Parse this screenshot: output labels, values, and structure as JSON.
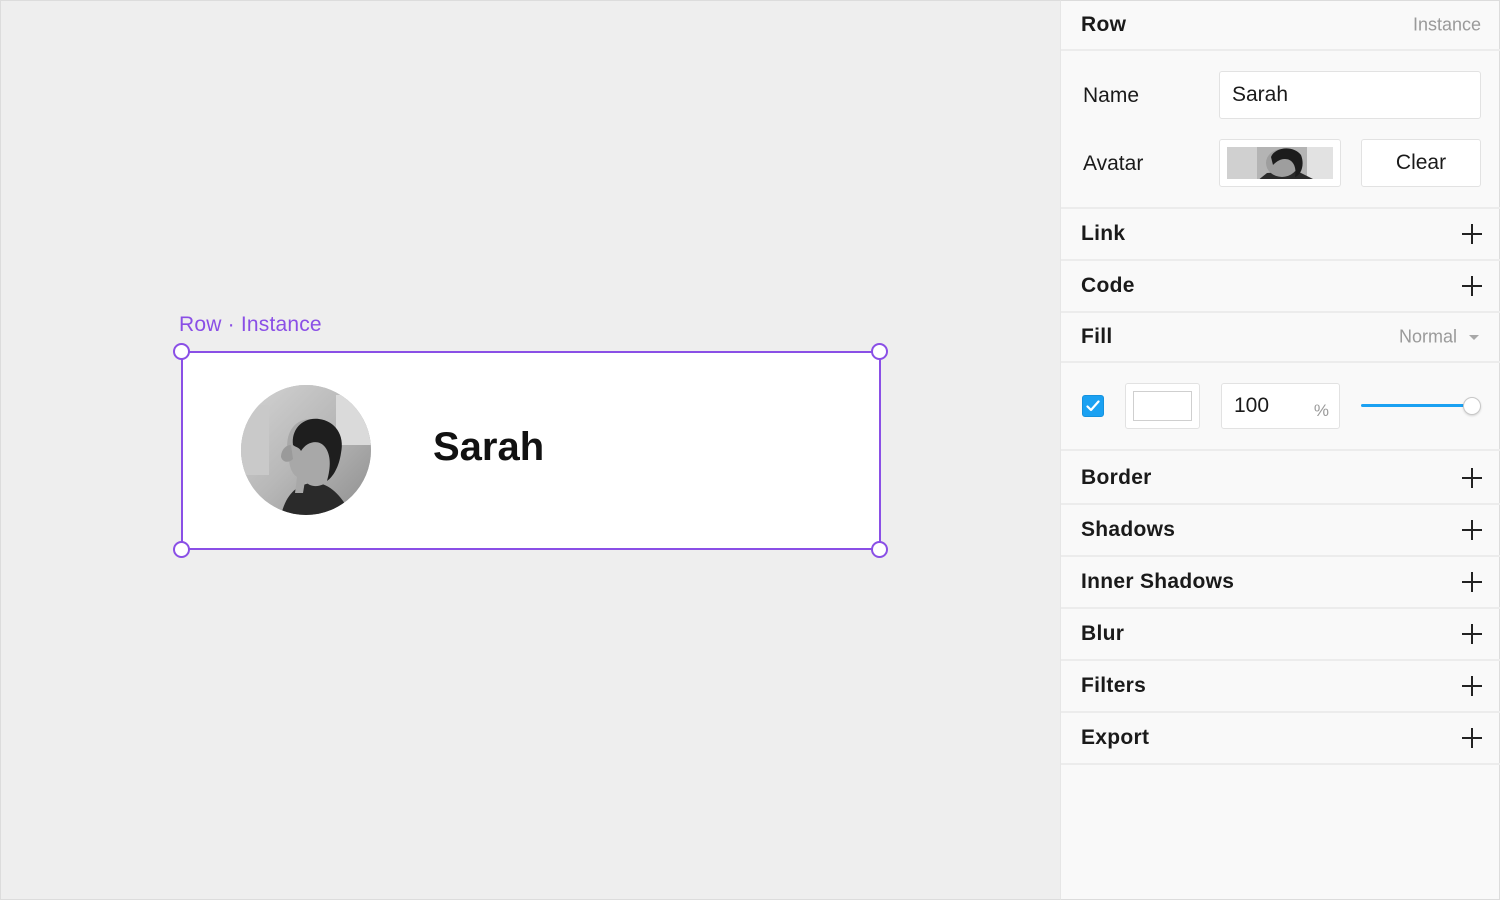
{
  "canvas": {
    "selection_label": {
      "component": "Row",
      "separator": "·",
      "kind": "Instance"
    },
    "instance": {
      "name": "Sarah",
      "avatar_icon": "portrait-photo"
    },
    "selection_color": "#8a4fe6"
  },
  "panel": {
    "header": {
      "title": "Row",
      "subtitle": "Instance"
    },
    "props": {
      "name_label": "Name",
      "name_value": "Sarah",
      "avatar_label": "Avatar",
      "clear_label": "Clear"
    },
    "sections": {
      "link": "Link",
      "code": "Code",
      "fill": "Fill",
      "fill_blend": "Normal",
      "border": "Border",
      "shadows": "Shadows",
      "inner_shadows": "Inner Shadows",
      "blur": "Blur",
      "filters": "Filters",
      "export": "Export"
    },
    "fill": {
      "enabled": true,
      "color": "#ffffff",
      "opacity": "100",
      "opacity_unit": "%",
      "opacity_slider_fraction": 1.0
    },
    "accent_color": "#1ba1f2"
  }
}
